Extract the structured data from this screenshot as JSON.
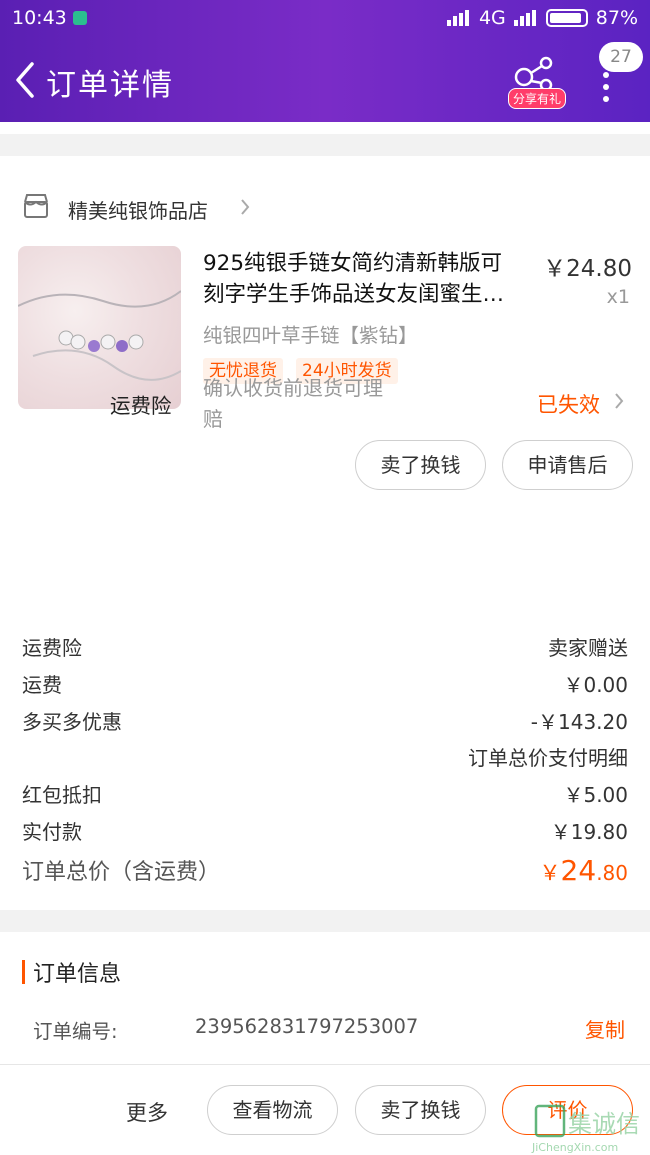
{
  "status_bar": {
    "time": "10:43",
    "network": "4G",
    "battery": "87%"
  },
  "header": {
    "title": "订单详情",
    "share_tag": "分享有礼",
    "badge": "27"
  },
  "shop": {
    "name": "精美纯银饰品店"
  },
  "product": {
    "title_line1": "925纯银手链女简约清新韩版可",
    "title_line2": "刻字学生手饰品送女友闺蜜生…",
    "price": "￥24.80",
    "qty": "x1",
    "sku": "纯银四叶草手链【紫钻】",
    "tags": [
      "无忧退货",
      "24小时发货"
    ]
  },
  "item_actions": {
    "sell": "卖了换钱",
    "after_sale": "申请售后"
  },
  "insurance": {
    "label": "运费险",
    "desc_line1": "确认收货前退货可理",
    "desc_line2": "赔",
    "status": "已失效"
  },
  "fees": {
    "ins_label": "运费险",
    "ins_value": "卖家赠送",
    "ship_label": "运费",
    "ship_value": "￥0.00",
    "promo_label": "多买多优惠",
    "promo_value": "-￥143.20",
    "detail_link": "订单总价支付明细",
    "redpack_label": "红包抵扣",
    "redpack_value": "￥5.00",
    "paid_label": "实付款",
    "paid_value": "￥19.80",
    "total_label": "订单总价（含运费）",
    "total_symbol": "￥",
    "total_int": "24",
    "total_dec": ".80"
  },
  "order_info": {
    "title": "订单信息",
    "number_label": "订单编号:",
    "number": "239562831797253007",
    "copy": "复制"
  },
  "bottom": {
    "more": "更多",
    "logistics": "查看物流",
    "sell": "卖了换钱",
    "review": "评价"
  },
  "watermark": {
    "text": "集诚信",
    "url": "JiChengXin.com"
  },
  "colors": {
    "accent": "#ff5500",
    "header_start": "#5a1fb3",
    "header_end": "#7a2cc7"
  }
}
